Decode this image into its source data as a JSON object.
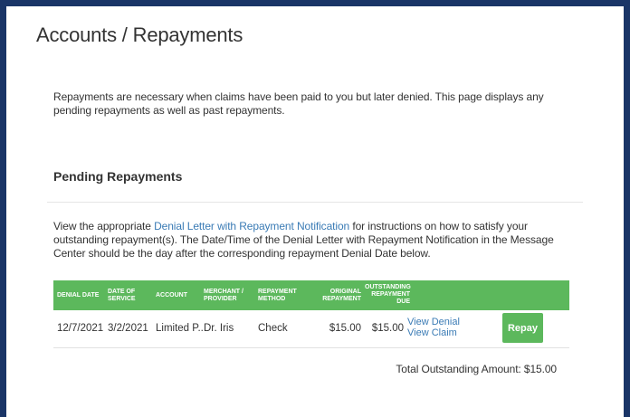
{
  "page": {
    "title": "Accounts / Repayments",
    "intro": "Repayments are necessary when claims have been paid to you but later denied. This page displays any pending repayments as well as past repayments."
  },
  "pending": {
    "heading": "Pending Repayments",
    "instructions_before": "View the appropriate ",
    "instructions_link": "Denial Letter with Repayment Notification",
    "instructions_after": " for instructions on how to satisfy your outstanding repayment(s). The Date/Time of the Denial Letter with Repayment Notification in the Message Center should be the day after the corresponding repayment Denial Date below."
  },
  "table": {
    "headers": {
      "denial_date": "DENIAL DATE",
      "date_of_service": "DATE OF SERVICE",
      "account": "ACCOUNT",
      "merchant": "MERCHANT / PROVIDER",
      "method": "REPAYMENT METHOD",
      "original": "ORIGINAL REPAYMENT",
      "outstanding": "OUTSTANDING REPAYMENT DUE"
    },
    "rows": [
      {
        "denial_date": "12/7/2021",
        "date_of_service": "3/2/2021",
        "account": "Limited P...",
        "merchant": "Dr. Iris",
        "method": "Check",
        "original": "$15.00",
        "outstanding": "$15.00",
        "view_denial": "View Denial",
        "view_claim": "View Claim",
        "repay": "Repay"
      }
    ]
  },
  "total": "Total Outstanding Amount: $15.00",
  "colors": {
    "frame": "#1a3567",
    "header_green": "#5cb85c",
    "link_blue": "#3a7bb5"
  }
}
